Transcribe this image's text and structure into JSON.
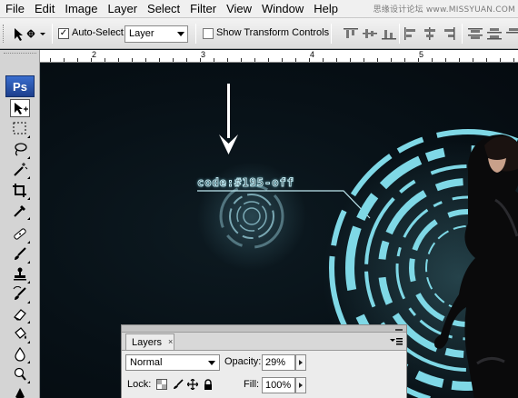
{
  "menu": {
    "items": [
      "File",
      "Edit",
      "Image",
      "Layer",
      "Select",
      "Filter",
      "View",
      "Window",
      "Help"
    ]
  },
  "watermark": "思缘设计论坛 www.MISSYUAN.COM",
  "options_bar": {
    "autoselect_label": "Auto-Select:",
    "autoselect_checked": true,
    "layer_select_value": "Layer",
    "transform_label": "Show Transform Controls",
    "transform_checked": false
  },
  "ruler": {
    "labels": [
      "2",
      "3",
      "4",
      "5"
    ]
  },
  "toolbox": {
    "logo": "Ps",
    "tools": [
      "move-tool",
      "marquee-tool",
      "lasso-tool",
      "magic-wand-tool",
      "crop-tool",
      "eyedropper-tool",
      "healing-brush-tool",
      "brush-tool",
      "clone-stamp-tool",
      "history-brush-tool",
      "eraser-tool",
      "paint-bucket-tool",
      "blur-tool",
      "dodge-tool"
    ],
    "active_tool": "move-tool"
  },
  "canvas": {
    "code_text": "code:#195-off"
  },
  "layers_panel": {
    "tab_label": "Layers",
    "tab_close": "×",
    "blend_mode": "Normal",
    "opacity_label": "Opacity:",
    "opacity_value": "29%",
    "lock_label": "Lock:",
    "fill_label": "Fill:",
    "fill_value": "100%"
  },
  "colors": {
    "hud_cyan": "#7fd8e6",
    "canvas_bg": "#071016",
    "ps_blue": "#2a56b0"
  }
}
